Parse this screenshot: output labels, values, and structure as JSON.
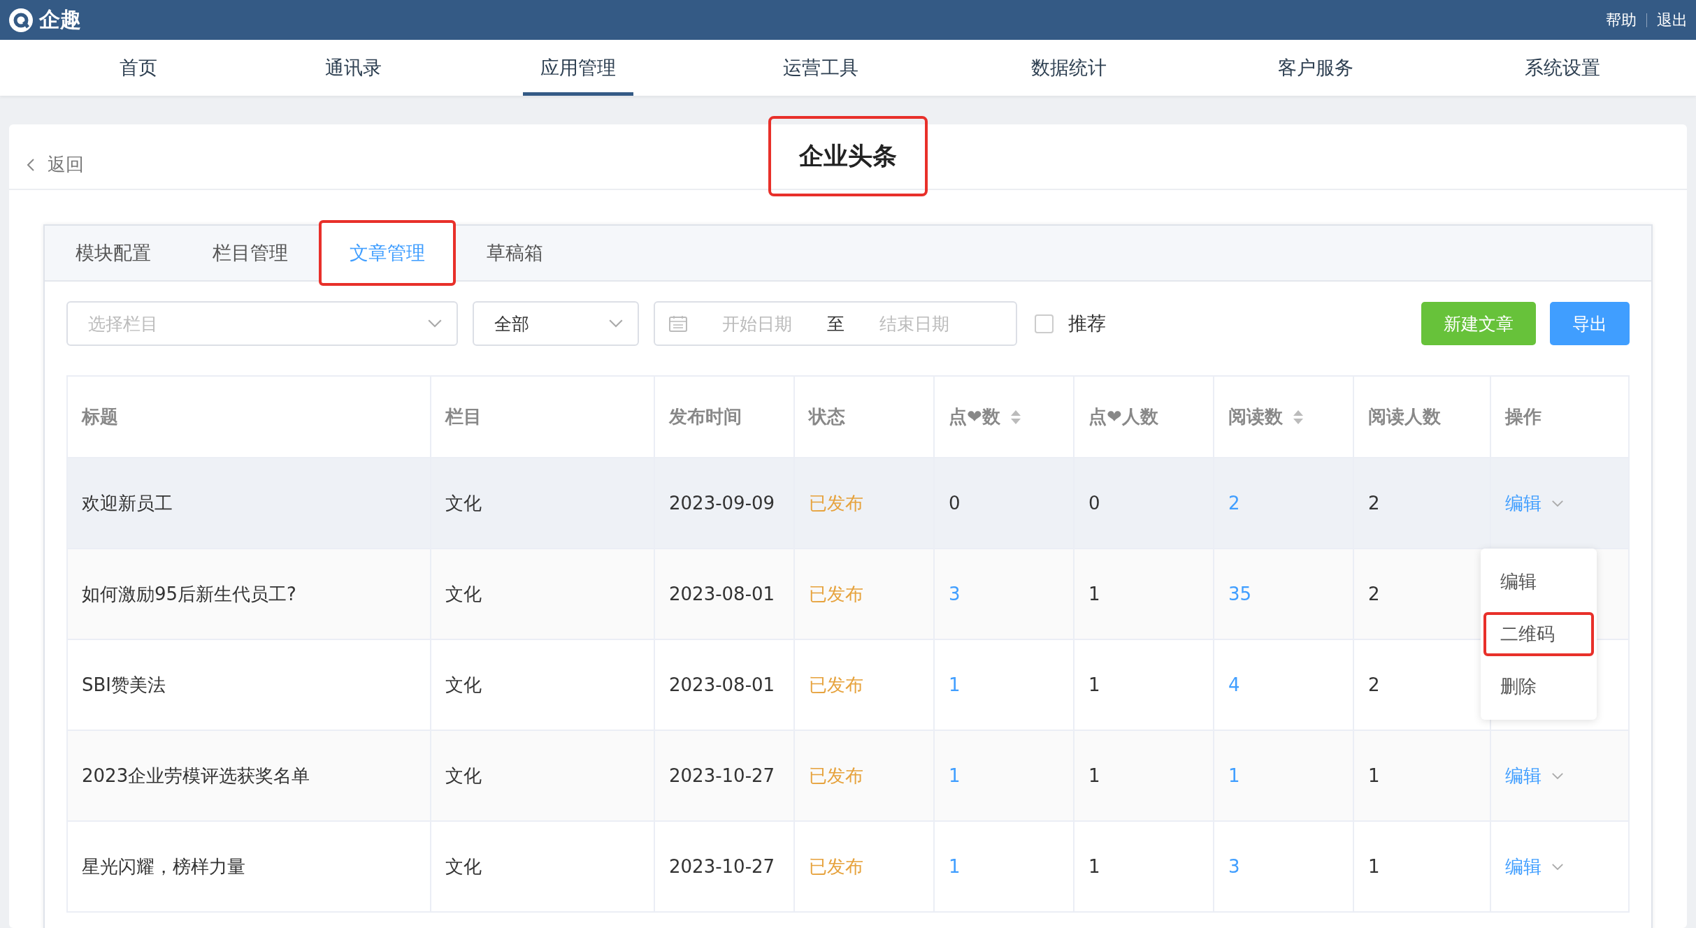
{
  "top_bar": {
    "logo_text": "企趣",
    "links": [
      "帮助",
      "退出"
    ]
  },
  "nav": [
    {
      "label": "首页",
      "selected": false
    },
    {
      "label": "通讯录",
      "selected": false
    },
    {
      "label": "应用管理",
      "selected": true
    },
    {
      "label": "运营工具",
      "selected": false
    },
    {
      "label": "数据统计",
      "selected": false
    },
    {
      "label": "客户服务",
      "selected": false
    },
    {
      "label": "系统设置",
      "selected": false
    }
  ],
  "header": {
    "back": "返回",
    "title": "企业头条",
    "title_highlighted": true
  },
  "tabs": [
    {
      "label": "模块配置",
      "selected": false,
      "highlighted": false
    },
    {
      "label": "栏目管理",
      "selected": false,
      "highlighted": false
    },
    {
      "label": "文章管理",
      "selected": true,
      "highlighted": true
    },
    {
      "label": "草稿箱",
      "selected": false,
      "highlighted": false
    }
  ],
  "filters": {
    "column_select": {
      "placeholder": "选择栏目"
    },
    "status_select": {
      "value": "全部"
    },
    "date_range": {
      "start_placeholder": "开始日期",
      "separator": "至",
      "end_placeholder": "结束日期"
    },
    "recommend": {
      "label": "推荐",
      "checked": false
    },
    "buttons": [
      {
        "label": "新建文章",
        "kind": "success"
      },
      {
        "label": "导出",
        "kind": "primary"
      }
    ]
  },
  "table": {
    "columns": [
      {
        "label": "标题",
        "sortable": false
      },
      {
        "label": "栏目",
        "sortable": false
      },
      {
        "label": "发布时间",
        "sortable": false
      },
      {
        "label": "状态",
        "sortable": false
      },
      {
        "label": "点❤数",
        "sortable": true
      },
      {
        "label": "点❤人数",
        "sortable": false
      },
      {
        "label": "阅读数",
        "sortable": true
      },
      {
        "label": "阅读人数",
        "sortable": false
      },
      {
        "label": "操作",
        "sortable": false
      }
    ],
    "rows": [
      {
        "hovered": true,
        "cells": [
          {
            "text": "欢迎新员工",
            "kind": "plain"
          },
          {
            "text": "文化",
            "kind": "plain"
          },
          {
            "text": "2023-09-09",
            "kind": "plain"
          },
          {
            "text": "已发布",
            "kind": "status"
          },
          {
            "text": "0",
            "kind": "plain"
          },
          {
            "text": "0",
            "kind": "plain"
          },
          {
            "text": "2",
            "kind": "link"
          },
          {
            "text": "2",
            "kind": "plain"
          }
        ],
        "action": "编辑"
      },
      {
        "hovered": false,
        "cells": [
          {
            "text": "如何激励95后新生代员工?",
            "kind": "plain"
          },
          {
            "text": "文化",
            "kind": "plain"
          },
          {
            "text": "2023-08-01",
            "kind": "plain"
          },
          {
            "text": "已发布",
            "kind": "status"
          },
          {
            "text": "3",
            "kind": "link"
          },
          {
            "text": "1",
            "kind": "plain"
          },
          {
            "text": "35",
            "kind": "link"
          },
          {
            "text": "2",
            "kind": "plain"
          }
        ]
      },
      {
        "hovered": false,
        "cells": [
          {
            "text": "SBI赞美法",
            "kind": "plain"
          },
          {
            "text": "文化",
            "kind": "plain"
          },
          {
            "text": "2023-08-01",
            "kind": "plain"
          },
          {
            "text": "已发布",
            "kind": "status"
          },
          {
            "text": "1",
            "kind": "link"
          },
          {
            "text": "1",
            "kind": "plain"
          },
          {
            "text": "4",
            "kind": "link"
          },
          {
            "text": "2",
            "kind": "plain"
          }
        ]
      },
      {
        "hovered": false,
        "cells": [
          {
            "text": "2023企业劳模评选获奖名单",
            "kind": "plain"
          },
          {
            "text": "文化",
            "kind": "plain"
          },
          {
            "text": "2023-10-27",
            "kind": "plain"
          },
          {
            "text": "已发布",
            "kind": "status"
          },
          {
            "text": "1",
            "kind": "link"
          },
          {
            "text": "1",
            "kind": "plain"
          },
          {
            "text": "1",
            "kind": "link"
          },
          {
            "text": "1",
            "kind": "plain"
          }
        ],
        "action": "编辑"
      },
      {
        "hovered": false,
        "cells": [
          {
            "text": "星光闪耀，榜样力量",
            "kind": "plain"
          },
          {
            "text": "文化",
            "kind": "plain"
          },
          {
            "text": "2023-10-27",
            "kind": "plain"
          },
          {
            "text": "已发布",
            "kind": "status"
          },
          {
            "text": "1",
            "kind": "link"
          },
          {
            "text": "1",
            "kind": "plain"
          },
          {
            "text": "3",
            "kind": "link"
          },
          {
            "text": "1",
            "kind": "plain"
          }
        ],
        "action": "编辑"
      }
    ],
    "action_menu": {
      "open": true,
      "items": [
        {
          "label": "编辑",
          "highlighted": false
        },
        {
          "label": "二维码",
          "highlighted": true
        },
        {
          "label": "删除",
          "highlighted": false
        }
      ]
    }
  }
}
